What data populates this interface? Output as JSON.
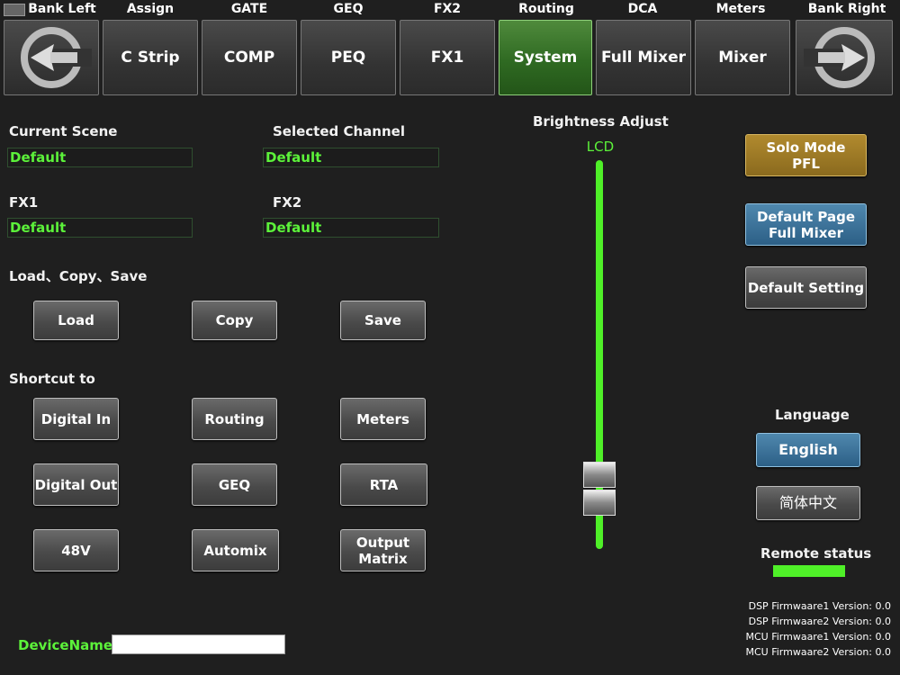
{
  "nav": {
    "labels": [
      "Bank Left",
      "Assign",
      "GATE",
      "GEQ",
      "FX2",
      "Routing",
      "DCA",
      "Meters",
      "Bank Right"
    ],
    "tabs": [
      "C Strip",
      "COMP",
      "PEQ",
      "FX1",
      "System",
      "Full Mixer",
      "Mixer"
    ],
    "active_tab": "System"
  },
  "scene": {
    "current_scene_label": "Current Scene",
    "current_scene_value": "Default",
    "selected_channel_label": "Selected Channel",
    "selected_channel_value": "Default",
    "fx1_label": "FX1",
    "fx1_value": "Default",
    "fx2_label": "FX2",
    "fx2_value": "Default"
  },
  "lcs": {
    "title": "Load、Copy、Save",
    "load": "Load",
    "copy": "Copy",
    "save": "Save"
  },
  "shortcut": {
    "title": "Shortcut to",
    "buttons": [
      "Digital In",
      "Routing",
      "Meters",
      "Digital Out",
      "GEQ",
      "RTA",
      "48V",
      "Automix",
      "Output Matrix"
    ]
  },
  "brightness": {
    "title": "Brightness Adjust",
    "channel": "LCD",
    "level": 0.1
  },
  "right": {
    "solo_line1": "Solo Mode",
    "solo_line2": "PFL",
    "default_page_line1": "Default Page",
    "default_page_line2": "Full Mixer",
    "default_setting": "Default Setting",
    "language_title": "Language",
    "english": "English",
    "chinese": "简体中文",
    "remote_title": "Remote status"
  },
  "firmware": [
    "DSP Firmwaare1 Version: 0.0",
    "DSP Firmwaare2 Version: 0.0",
    "MCU Firmwaare1 Version: 0.0",
    "MCU Firmwaare2 Version: 0.0"
  ],
  "device": {
    "label": "DeviceName",
    "value": ""
  },
  "colors": {
    "active": "#2f6a22",
    "green_text": "#5cf23a",
    "gold": "#8a6a1e",
    "blue": "#2c5f86"
  }
}
